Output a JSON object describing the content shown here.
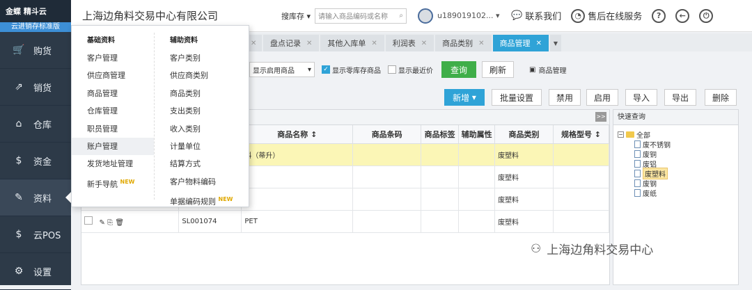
{
  "sidebar": {
    "brand": "金蝶 精斗云",
    "edition": "云进销存标准版",
    "items": [
      {
        "label": "购货",
        "icon": "cart-icon"
      },
      {
        "label": "销货",
        "icon": "sales-icon"
      },
      {
        "label": "仓库",
        "icon": "warehouse-icon"
      },
      {
        "label": "资金",
        "icon": "money-icon"
      },
      {
        "label": "资料",
        "icon": "pencil-icon"
      },
      {
        "label": "云POS",
        "icon": "pos-icon"
      },
      {
        "label": "设置",
        "icon": "gear-icon"
      }
    ]
  },
  "topbar": {
    "company": "上海边角料交易中心有限公司",
    "search_scope": "搜库存",
    "search_placeholder": "请输入商品编码或名称",
    "user": "u189019102...",
    "contact": "联系我们",
    "service": "售后在线服务"
  },
  "tabs": [
    {
      "label": "盘点记录",
      "active": false
    },
    {
      "label": "其他入库单",
      "active": false
    },
    {
      "label": "利润表",
      "active": false
    },
    {
      "label": "商品类别",
      "active": false
    },
    {
      "label": "商品管理",
      "active": true
    }
  ],
  "filter": {
    "select": "显示启用商品",
    "zero_stock": "显示零库存商品",
    "recent_price": "显示最近价",
    "query": "查询",
    "refresh": "刷新",
    "product_link": "商品管理"
  },
  "toolbar": {
    "add": "新增",
    "batch": "批量设置",
    "disable": "禁用",
    "enable": "启用",
    "import": "导入",
    "export": "导出",
    "delete": "删除"
  },
  "grid": {
    "columns": [
      "商品名称",
      "商品条码",
      "商品标签",
      "辅助属性",
      "商品类别",
      "规格型号"
    ],
    "rows": [
      {
        "code": "",
        "name": "料（蒂升）",
        "category": "废塑料"
      },
      {
        "code": "",
        "name": "",
        "category": "废塑料"
      },
      {
        "code": "",
        "name": "",
        "category": "废塑料"
      },
      {
        "code": "SL001074",
        "name": "PET",
        "category": "废塑料"
      }
    ]
  },
  "quick": {
    "title": "快速查询",
    "root": "全部",
    "nodes": [
      "废不锈钢",
      "废铜",
      "废铝",
      "废塑料",
      "废钢",
      "废纸"
    ],
    "selected": "废塑料"
  },
  "menu": {
    "basic_title": "基础资料",
    "basic": [
      "客户管理",
      "供应商管理",
      "商品管理",
      "仓库管理",
      "职员管理",
      "账户管理",
      "发货地址管理",
      "新手导航"
    ],
    "aux_title": "辅助资料",
    "aux": [
      "客户类别",
      "供应商类别",
      "商品类别",
      "支出类别",
      "收入类别",
      "计量单位",
      "结算方式",
      "客户物料编码",
      "单据编码规则"
    ],
    "new_badge": "NEW"
  },
  "watermark": "上海边角料交易中心"
}
